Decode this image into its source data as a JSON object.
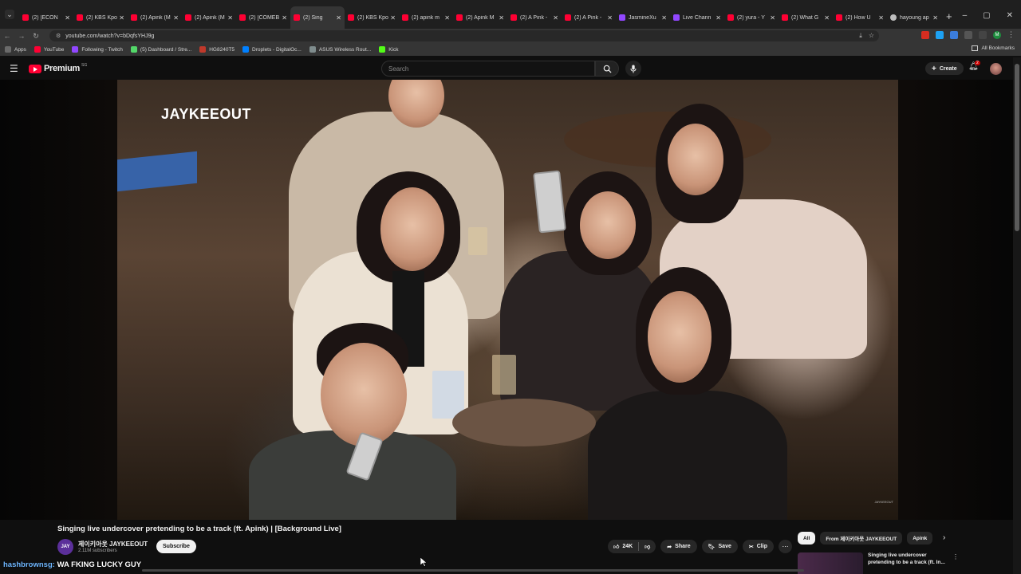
{
  "browser": {
    "tabs": [
      {
        "title": "(2) [ECON",
        "fav": "youtube"
      },
      {
        "title": "(2) KBS Kpop",
        "fav": "youtube"
      },
      {
        "title": "(2) Apink (M",
        "fav": "youtube"
      },
      {
        "title": "(2) Apink (M",
        "fav": "youtube"
      },
      {
        "title": "(2) [COMEB",
        "fav": "youtube"
      },
      {
        "title": "(2) Sing",
        "fav": "youtube",
        "active": true
      },
      {
        "title": "(2) KBS Kpo",
        "fav": "youtube"
      },
      {
        "title": "(2) apink m",
        "fav": "youtube"
      },
      {
        "title": "(2) Apink M",
        "fav": "youtube"
      },
      {
        "title": "(2) A Pink -",
        "fav": "youtube"
      },
      {
        "title": "(2) A Pink -",
        "fav": "youtube"
      },
      {
        "title": "JasmineXu",
        "fav": "twitch"
      },
      {
        "title": "Live Chann",
        "fav": "twitch"
      },
      {
        "title": "(2) yura - Y",
        "fav": "youtube"
      },
      {
        "title": "(2) What G",
        "fav": "youtube"
      },
      {
        "title": "(2) How U",
        "fav": "youtube"
      },
      {
        "title": "hayoung ap",
        "fav": "google"
      }
    ],
    "url": "youtube.com/watch?v=bDqfsYHJ9g",
    "bookmarks": [
      {
        "label": "Apps",
        "color": "#6a6a6a"
      },
      {
        "label": "YouTube",
        "color": "#ff0033"
      },
      {
        "label": "Following - Twitch",
        "color": "#9147ff"
      },
      {
        "label": "(5) Dashboard / Stre...",
        "color": "#53d769"
      },
      {
        "label": "HG8240T5",
        "color": "#c0392b"
      },
      {
        "label": "Droplets - DigitalOc...",
        "color": "#0080ff"
      },
      {
        "label": "ASUS Wireless Rout...",
        "color": "#7f8c8d"
      },
      {
        "label": "Kick",
        "color": "#53fc18"
      }
    ],
    "all_bookmarks": "All Bookmarks"
  },
  "yt": {
    "logo_text": "Premium",
    "logo_sup": "SG",
    "search_placeholder": "Search",
    "create_label": "Create",
    "notif_count": "2"
  },
  "video": {
    "watermark": "JAYKEEOUT",
    "corner_mark": "JAYKEEOUT",
    "title": "Singing live undercover pretending to be a track (ft. Apink) | [Background Live]",
    "channel_avatar": "JAY",
    "channel_name": "제이키아웃 JAYKEEOUT",
    "subscribers": "2.11M subscribers",
    "subscribe_label": "Subscribe",
    "likes": "24K",
    "share_label": "Share",
    "save_label": "Save",
    "clip_label": "Clip"
  },
  "chips": [
    "All",
    "From 제이키아웃 JAYKEEOUT",
    "Apink"
  ],
  "recommendation": {
    "title": "Singing live undercover pretending to be a track (ft. In..."
  },
  "overlay": {
    "user": "hashbrownsg:",
    "message": "WA FKING LUCKY GUY"
  },
  "colors": {
    "brand_red": "#ff0033",
    "page_bg": "#0f0f0f",
    "chip_bg": "#272727"
  }
}
